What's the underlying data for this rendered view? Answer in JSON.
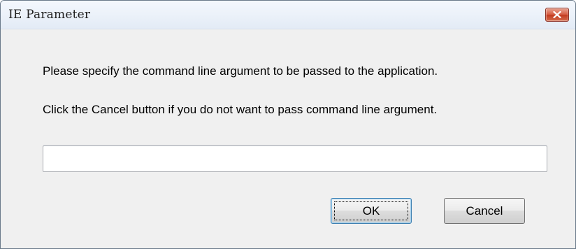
{
  "window": {
    "title": "IE Parameter",
    "close_icon": "close-icon"
  },
  "dialog": {
    "message_line_1": "Please specify the command line argument to be passed to the application.",
    "message_line_2": "Click the Cancel button if you do not want to pass command line argument.",
    "argument_value": "",
    "ok_label": "OK",
    "cancel_label": "Cancel"
  },
  "colors": {
    "close_button": "#c94a2f",
    "focus_accent": "#3c7fb1"
  }
}
